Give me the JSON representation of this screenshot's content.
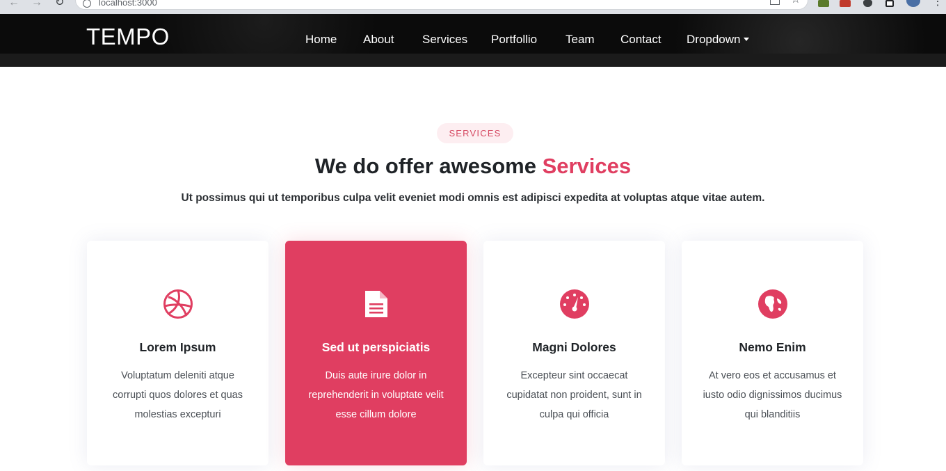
{
  "browser": {
    "url": "localhost:3000"
  },
  "header": {
    "logo": "TEMPO",
    "nav": [
      {
        "label": "Home"
      },
      {
        "label": "About"
      },
      {
        "label": "Services"
      },
      {
        "label": "Portfollio"
      },
      {
        "label": "Team"
      },
      {
        "label": "Contact"
      },
      {
        "label": "Dropdown"
      }
    ]
  },
  "services": {
    "badge": "SERVICES",
    "title_prefix": "We do offer awesome ",
    "title_accent": "Services",
    "subtitle": "Ut possimus qui ut temporibus culpa velit eveniet modi omnis est adipisci expedita at voluptas atque vitae autem.",
    "cards": [
      {
        "icon": "dribbble-icon",
        "title": "Lorem Ipsum",
        "text": "Voluptatum deleniti atque corrupti quos dolores et quas molestias excepturi",
        "active": false
      },
      {
        "icon": "file-text-icon",
        "title": "Sed ut perspiciatis",
        "text": "Duis aute irure dolor in reprehenderit in voluptate velit esse cillum dolore",
        "active": true
      },
      {
        "icon": "speedometer-icon",
        "title": "Magni Dolores",
        "text": "Excepteur sint occaecat cupidatat non proident, sunt in culpa qui officia",
        "active": false
      },
      {
        "icon": "globe-icon",
        "title": "Nemo Enim",
        "text": "At vero eos et accusamus et iusto odio dignissimos ducimus qui blanditiis",
        "active": false
      }
    ]
  },
  "colors": {
    "accent": "#e03e61",
    "header_bg": "#0b0b0b",
    "badge_bg": "#fdeef1"
  }
}
